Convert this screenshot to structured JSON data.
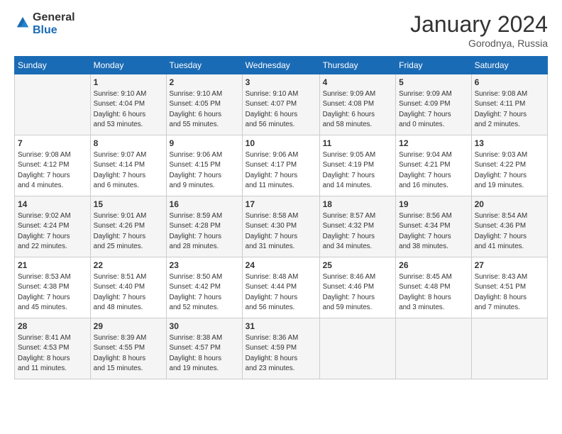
{
  "header": {
    "logo_general": "General",
    "logo_blue": "Blue",
    "month_title": "January 2024",
    "location": "Gorodnya, Russia"
  },
  "weekdays": [
    "Sunday",
    "Monday",
    "Tuesday",
    "Wednesday",
    "Thursday",
    "Friday",
    "Saturday"
  ],
  "weeks": [
    [
      {
        "day": "",
        "info": ""
      },
      {
        "day": "1",
        "info": "Sunrise: 9:10 AM\nSunset: 4:04 PM\nDaylight: 6 hours\nand 53 minutes."
      },
      {
        "day": "2",
        "info": "Sunrise: 9:10 AM\nSunset: 4:05 PM\nDaylight: 6 hours\nand 55 minutes."
      },
      {
        "day": "3",
        "info": "Sunrise: 9:10 AM\nSunset: 4:07 PM\nDaylight: 6 hours\nand 56 minutes."
      },
      {
        "day": "4",
        "info": "Sunrise: 9:09 AM\nSunset: 4:08 PM\nDaylight: 6 hours\nand 58 minutes."
      },
      {
        "day": "5",
        "info": "Sunrise: 9:09 AM\nSunset: 4:09 PM\nDaylight: 7 hours\nand 0 minutes."
      },
      {
        "day": "6",
        "info": "Sunrise: 9:08 AM\nSunset: 4:11 PM\nDaylight: 7 hours\nand 2 minutes."
      }
    ],
    [
      {
        "day": "7",
        "info": "Sunrise: 9:08 AM\nSunset: 4:12 PM\nDaylight: 7 hours\nand 4 minutes."
      },
      {
        "day": "8",
        "info": "Sunrise: 9:07 AM\nSunset: 4:14 PM\nDaylight: 7 hours\nand 6 minutes."
      },
      {
        "day": "9",
        "info": "Sunrise: 9:06 AM\nSunset: 4:15 PM\nDaylight: 7 hours\nand 9 minutes."
      },
      {
        "day": "10",
        "info": "Sunrise: 9:06 AM\nSunset: 4:17 PM\nDaylight: 7 hours\nand 11 minutes."
      },
      {
        "day": "11",
        "info": "Sunrise: 9:05 AM\nSunset: 4:19 PM\nDaylight: 7 hours\nand 14 minutes."
      },
      {
        "day": "12",
        "info": "Sunrise: 9:04 AM\nSunset: 4:21 PM\nDaylight: 7 hours\nand 16 minutes."
      },
      {
        "day": "13",
        "info": "Sunrise: 9:03 AM\nSunset: 4:22 PM\nDaylight: 7 hours\nand 19 minutes."
      }
    ],
    [
      {
        "day": "14",
        "info": "Sunrise: 9:02 AM\nSunset: 4:24 PM\nDaylight: 7 hours\nand 22 minutes."
      },
      {
        "day": "15",
        "info": "Sunrise: 9:01 AM\nSunset: 4:26 PM\nDaylight: 7 hours\nand 25 minutes."
      },
      {
        "day": "16",
        "info": "Sunrise: 8:59 AM\nSunset: 4:28 PM\nDaylight: 7 hours\nand 28 minutes."
      },
      {
        "day": "17",
        "info": "Sunrise: 8:58 AM\nSunset: 4:30 PM\nDaylight: 7 hours\nand 31 minutes."
      },
      {
        "day": "18",
        "info": "Sunrise: 8:57 AM\nSunset: 4:32 PM\nDaylight: 7 hours\nand 34 minutes."
      },
      {
        "day": "19",
        "info": "Sunrise: 8:56 AM\nSunset: 4:34 PM\nDaylight: 7 hours\nand 38 minutes."
      },
      {
        "day": "20",
        "info": "Sunrise: 8:54 AM\nSunset: 4:36 PM\nDaylight: 7 hours\nand 41 minutes."
      }
    ],
    [
      {
        "day": "21",
        "info": "Sunrise: 8:53 AM\nSunset: 4:38 PM\nDaylight: 7 hours\nand 45 minutes."
      },
      {
        "day": "22",
        "info": "Sunrise: 8:51 AM\nSunset: 4:40 PM\nDaylight: 7 hours\nand 48 minutes."
      },
      {
        "day": "23",
        "info": "Sunrise: 8:50 AM\nSunset: 4:42 PM\nDaylight: 7 hours\nand 52 minutes."
      },
      {
        "day": "24",
        "info": "Sunrise: 8:48 AM\nSunset: 4:44 PM\nDaylight: 7 hours\nand 56 minutes."
      },
      {
        "day": "25",
        "info": "Sunrise: 8:46 AM\nSunset: 4:46 PM\nDaylight: 7 hours\nand 59 minutes."
      },
      {
        "day": "26",
        "info": "Sunrise: 8:45 AM\nSunset: 4:48 PM\nDaylight: 8 hours\nand 3 minutes."
      },
      {
        "day": "27",
        "info": "Sunrise: 8:43 AM\nSunset: 4:51 PM\nDaylight: 8 hours\nand 7 minutes."
      }
    ],
    [
      {
        "day": "28",
        "info": "Sunrise: 8:41 AM\nSunset: 4:53 PM\nDaylight: 8 hours\nand 11 minutes."
      },
      {
        "day": "29",
        "info": "Sunrise: 8:39 AM\nSunset: 4:55 PM\nDaylight: 8 hours\nand 15 minutes."
      },
      {
        "day": "30",
        "info": "Sunrise: 8:38 AM\nSunset: 4:57 PM\nDaylight: 8 hours\nand 19 minutes."
      },
      {
        "day": "31",
        "info": "Sunrise: 8:36 AM\nSunset: 4:59 PM\nDaylight: 8 hours\nand 23 minutes."
      },
      {
        "day": "",
        "info": ""
      },
      {
        "day": "",
        "info": ""
      },
      {
        "day": "",
        "info": ""
      }
    ]
  ]
}
